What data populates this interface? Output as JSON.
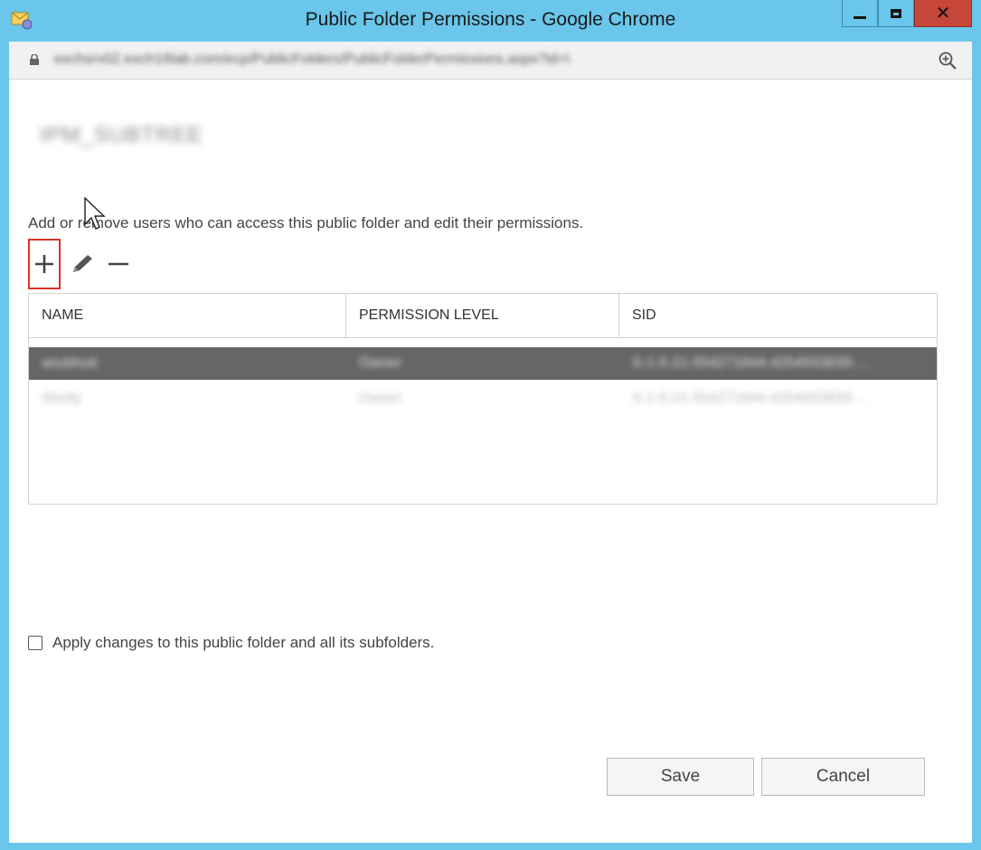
{
  "window": {
    "title": "Public Folder Permissions - Google Chrome",
    "close_glyph": "✕"
  },
  "address": {
    "url": "exchsrv02.exch16lab.com/ecp/PublicFolders/PublicFolderPermissions.aspx?id=\\"
  },
  "header": {
    "folder_name": "IPM_SUBTREE"
  },
  "instructions": "Add or remove users who can access this public folder and edit their permissions.",
  "toolbar": {
    "add": "add",
    "edit": "edit",
    "remove": "remove"
  },
  "table": {
    "columns": [
      "NAME",
      "PERMISSION LEVEL",
      "SID"
    ],
    "rows": [
      {
        "name": "anubhuti",
        "permission": "Owner",
        "sid": "S-1-5-21-554271844-4254933839-...",
        "selected": true
      },
      {
        "name": "Shelly",
        "permission": "Owner",
        "sid": "S-1-5-21-554271844-4254933839-...",
        "selected": false
      }
    ]
  },
  "apply_subfolders": {
    "label": "Apply changes to this public folder and all its subfolders.",
    "checked": false
  },
  "buttons": {
    "save": "Save",
    "cancel": "Cancel"
  },
  "colors": {
    "frame": "#6ac6ea",
    "selected_row": "#666666",
    "highlight": "#d9342b",
    "close_button": "#c7463a"
  }
}
